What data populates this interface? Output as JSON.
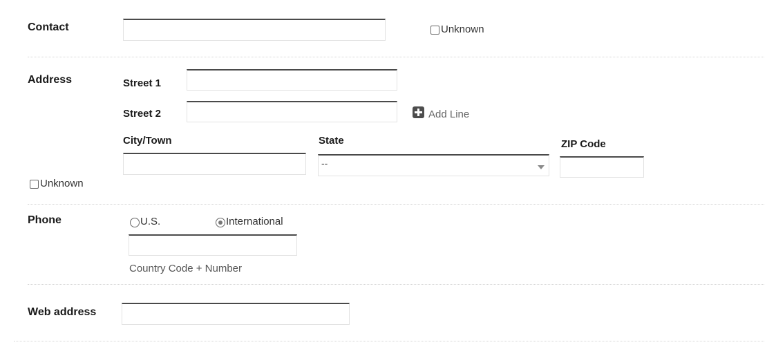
{
  "contact": {
    "label": "Contact",
    "value": "",
    "unknown_label": "Unknown"
  },
  "address": {
    "label": "Address",
    "street1_label": "Street 1",
    "street1_value": "",
    "street2_label": "Street 2",
    "street2_value": "",
    "add_line_label": "Add Line",
    "city_label": "City/Town",
    "city_value": "",
    "state_label": "State",
    "state_selected": "--",
    "zip_label": "ZIP Code",
    "zip_value": "",
    "unknown_label": "Unknown"
  },
  "phone": {
    "label": "Phone",
    "options": [
      "U.S.",
      "International"
    ],
    "selected": "International",
    "value": "",
    "hint": "Country Code + Number"
  },
  "web": {
    "label": "Web address",
    "value": ""
  },
  "colors": {
    "input_top_border": "#4a4a4a",
    "input_border": "#e2e2e2",
    "divider": "#d6d6d6",
    "add_icon": "#4d4d4d"
  },
  "icons": {
    "add_line": "plus-square-icon",
    "state_dropdown": "chevron-down-icon"
  }
}
